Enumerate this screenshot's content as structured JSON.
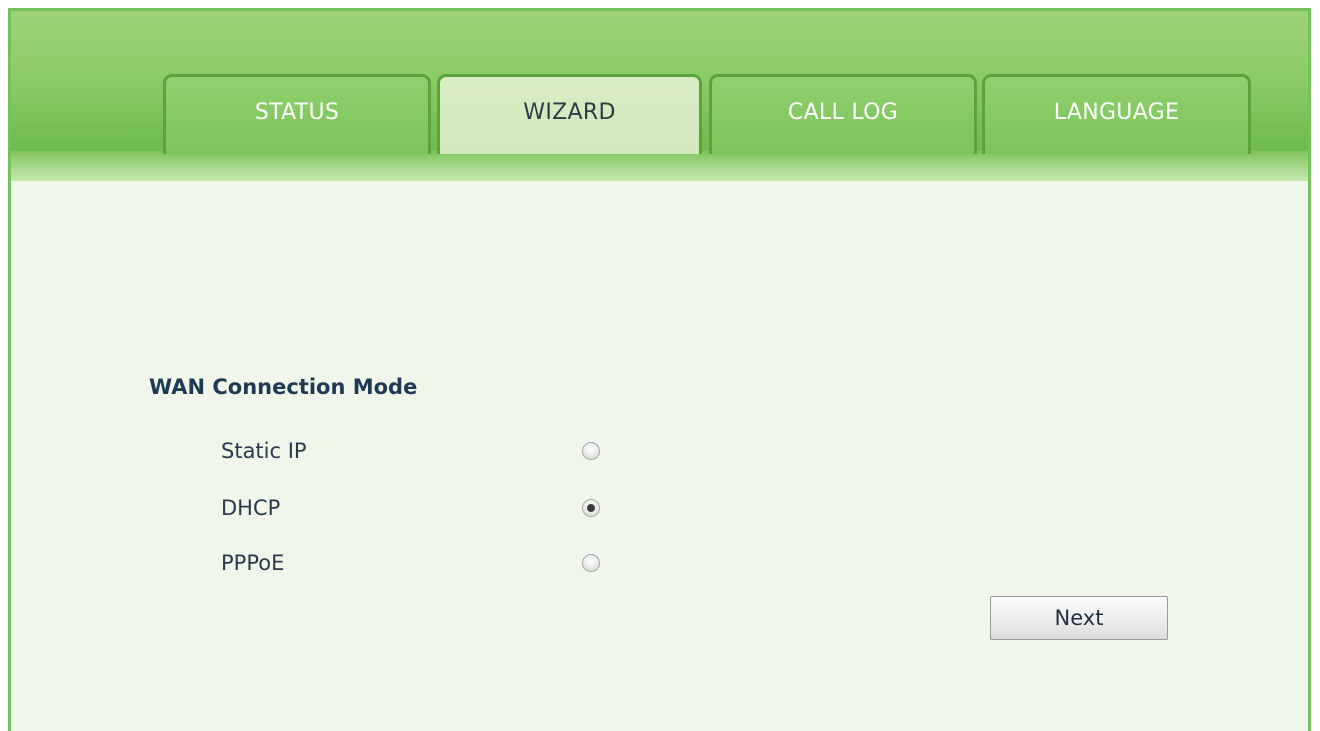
{
  "tabs": [
    {
      "label": "STATUS",
      "active": false
    },
    {
      "label": "WIZARD",
      "active": true
    },
    {
      "label": "CALL LOG",
      "active": false
    },
    {
      "label": "LANGUAGE",
      "active": false
    }
  ],
  "wan": {
    "title": "WAN Connection Mode",
    "options": [
      {
        "label": "Static IP",
        "checked": false
      },
      {
        "label": "DHCP",
        "checked": true
      },
      {
        "label": "PPPoE",
        "checked": false
      }
    ],
    "selected": "DHCP"
  },
  "buttons": {
    "next_label": "Next"
  },
  "colors": {
    "header_green": "#8bcc66",
    "tab_border": "#5aa33d",
    "active_tab": "#d9ecc4",
    "content_bg": "#f0f6ea",
    "title_text": "#1f3a55"
  }
}
